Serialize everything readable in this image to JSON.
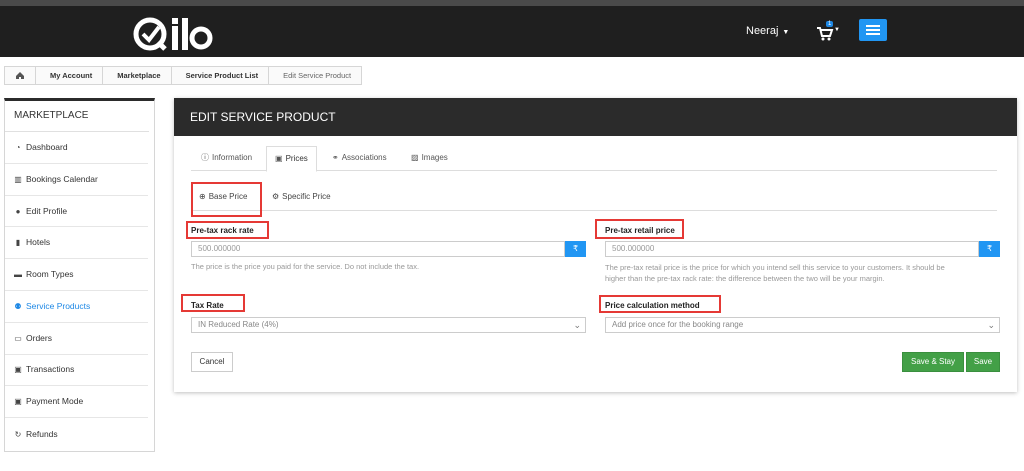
{
  "header": {
    "user_name": "Neeraj",
    "cart_badge": "1",
    "brand_color": "#1f1f1f",
    "accent_color": "#2196f3"
  },
  "breadcrumb": {
    "home_icon": "home-icon",
    "items": [
      "My Account",
      "Marketplace",
      "Service Product List",
      "Edit Service Product"
    ]
  },
  "sidebar": {
    "title": "MARKETPLACE",
    "items": [
      {
        "label": "Dashboard",
        "icon": "dashboard-icon"
      },
      {
        "label": "Bookings Calendar",
        "icon": "bar-chart-icon"
      },
      {
        "label": "Edit Profile",
        "icon": "user-icon"
      },
      {
        "label": "Hotels",
        "icon": "building-icon"
      },
      {
        "label": "Room Types",
        "icon": "bed-icon"
      },
      {
        "label": "Service Products",
        "icon": "users-icon"
      },
      {
        "label": "Orders",
        "icon": "credit-card-icon"
      },
      {
        "label": "Transactions",
        "icon": "money-icon"
      },
      {
        "label": "Payment Mode",
        "icon": "money-icon"
      },
      {
        "label": "Refunds",
        "icon": "refresh-icon"
      }
    ]
  },
  "panel": {
    "title": "EDIT SERVICE PRODUCT",
    "tabs": [
      {
        "label": "Information",
        "icon": "info-icon"
      },
      {
        "label": "Prices",
        "icon": "money-icon"
      },
      {
        "label": "Associations",
        "icon": "link-icon"
      },
      {
        "label": "Images",
        "icon": "image-icon"
      }
    ],
    "subtabs": [
      {
        "label": "Base Price",
        "icon": "globe-icon"
      },
      {
        "label": "Specific Price",
        "icon": "cogs-icon"
      }
    ],
    "rack_rate": {
      "label": "Pre-tax rack rate",
      "value": "500.000000",
      "currency": "₹",
      "help": "The price is the price you paid for the service. Do not include the tax."
    },
    "retail_price": {
      "label": "Pre-tax retail price",
      "value": "500.000000",
      "currency": "₹",
      "help_line1": "The pre-tax retail price is the price for which you intend sell this service to your customers. It should be",
      "help_line2": "higher than the pre-tax rack rate: the difference between the two will be your margin."
    },
    "tax_rate": {
      "label": "Tax Rate",
      "selected": "IN Reduced Rate (4%)"
    },
    "calc_method": {
      "label": "Price calculation method",
      "selected": "Add price once for the booking range"
    },
    "buttons": {
      "cancel": "Cancel",
      "save_stay": "Save & Stay",
      "save": "Save"
    }
  }
}
